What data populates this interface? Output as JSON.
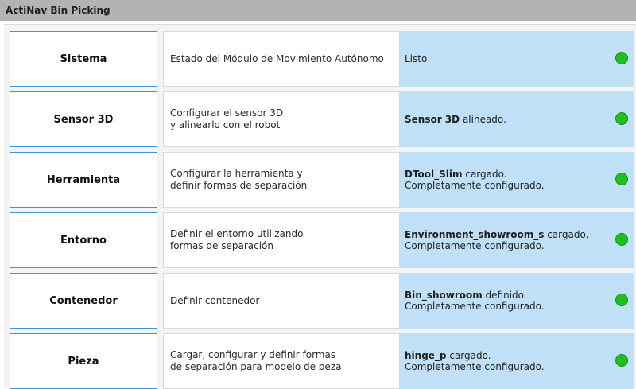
{
  "window": {
    "title": "ActiNav Bin Picking"
  },
  "colors": {
    "button_border": "#3c97d8",
    "status_bg": "#bfe0f6",
    "status_ok": "#1ec01e"
  },
  "rows": [
    {
      "button": "Sistema",
      "desc": [
        "Estado del Módulo de Movimiento Autónomo"
      ],
      "status": {
        "bold": "",
        "text": "Listo",
        "line2": ""
      },
      "indicator": "green-status-dot"
    },
    {
      "button": "Sensor 3D",
      "desc": [
        "Configurar el sensor 3D",
        "y alinearlo con el robot"
      ],
      "status": {
        "bold": "Sensor 3D",
        "text": " alineado.",
        "line2": ""
      },
      "indicator": "green-status-dot"
    },
    {
      "button": "Herramienta",
      "desc": [
        "Configurar la herramienta y",
        "definir formas de separación"
      ],
      "status": {
        "bold": "DTool_Slim",
        "text": " cargado.",
        "line2": "Completamente configurado."
      },
      "indicator": "green-status-dot"
    },
    {
      "button": "Entorno",
      "desc": [
        "Definir el entorno utilizando",
        "formas de separación"
      ],
      "status": {
        "bold": "Environment_showroom_s",
        "text": " cargado.",
        "line2": "Completamente configurado."
      },
      "indicator": "green-status-dot"
    },
    {
      "button": "Contenedor",
      "desc": [
        "Definir contenedor"
      ],
      "status": {
        "bold": "Bin_showroom",
        "text": " definido.",
        "line2": "Completamente configurado."
      },
      "indicator": "green-status-dot"
    },
    {
      "button": "Pieza",
      "desc": [
        "Cargar, configurar y definir formas",
        "de separación para modelo de peza"
      ],
      "status": {
        "bold": "hinge_p",
        "text": " cargado.",
        "line2": "Completamente configurado."
      },
      "indicator": "green-status-dot"
    }
  ]
}
